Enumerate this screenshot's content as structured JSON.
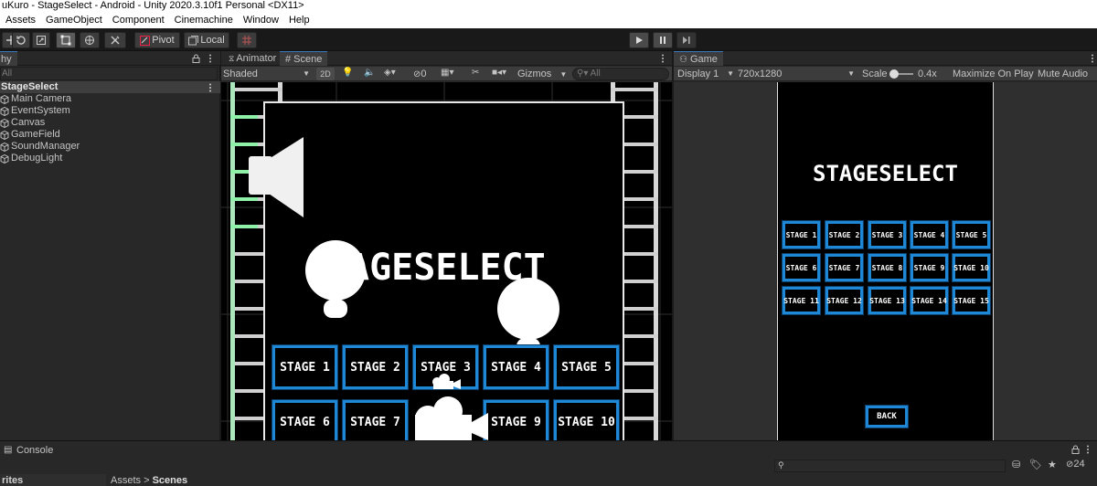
{
  "window": {
    "title": "uKuro - StageSelect - Android - Unity 2020.3.10f1 Personal <DX11>"
  },
  "menu": [
    "Assets",
    "GameObject",
    "Component",
    "Cinemachine",
    "Window",
    "Help"
  ],
  "toolbar": {
    "pivot_label": "Pivot",
    "local_label": "Local"
  },
  "hierarchy": {
    "tab_label": "hy",
    "search_placeholder": "All",
    "scene_name": "StageSelect",
    "items": [
      "Main Camera",
      "EventSystem",
      "Canvas",
      "GameField",
      "SoundManager",
      "DebugLight"
    ]
  },
  "scene": {
    "tabs": {
      "animator": "Animator",
      "scene": "Scene"
    },
    "shading_mode": "Shaded",
    "mode_2d": "2D",
    "hidden_count": "0",
    "gizmos_label": "Gizmos",
    "search_placeholder": "All",
    "title_text": "AGESELECT",
    "stage_labels": [
      "STAGE 1",
      "STAGE 2",
      "STAGE 3",
      "STAGE 4",
      "STAGE 5",
      "STAGE 6",
      "STAGE 7",
      "STAGE 9",
      "STAGE 10"
    ]
  },
  "game": {
    "tab_label": "Game",
    "display": "Display 1",
    "resolution": "720x1280",
    "scale_label": "Scale",
    "scale_value": "0.4x",
    "maximize_label": "Maximize On Play",
    "mute_label": "Mute Audio",
    "title_text": "STAGESELECT",
    "stage_labels": [
      "STAGE 1",
      "STAGE 2",
      "STAGE 3",
      "STAGE 4",
      "STAGE 5",
      "STAGE 6",
      "STAGE 7",
      "STAGE 8",
      "STAGE 9",
      "STAGE 10",
      "STAGE 11",
      "STAGE 12",
      "STAGE 13",
      "STAGE 14",
      "STAGE 15"
    ],
    "back_label": "BACK"
  },
  "bottom": {
    "console_label": "Console",
    "notification_count": "24",
    "left_label": "rites",
    "breadcrumb_root": "Assets",
    "breadcrumb_sep": ">",
    "breadcrumb_leaf": "Scenes"
  },
  "colors": {
    "accent": "#3a79bb",
    "stage_border": "#1e87d6",
    "ladder_glow": "#7cf29a"
  }
}
